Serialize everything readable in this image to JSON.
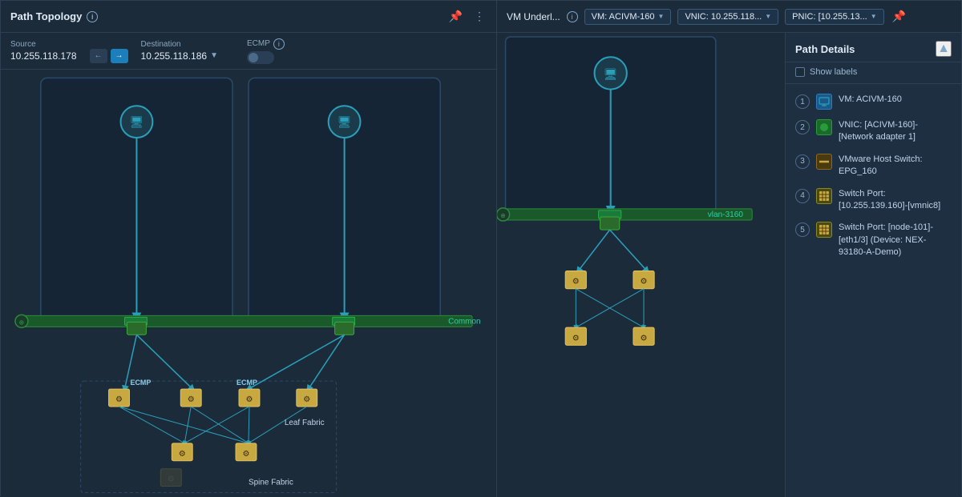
{
  "leftPanel": {
    "title": "Path Topology",
    "source": {
      "label": "Source",
      "value": "10.255.118.178"
    },
    "destination": {
      "label": "Destination",
      "value": "10.255.118.186"
    },
    "ecmp": {
      "label": "ECMP"
    },
    "commonLabel": "Common",
    "ecmpLabel1": "ECMP",
    "ecmpLabel2": "ECMP",
    "leafFabricLabel": "Leaf Fabric",
    "spineFabricLabel": "Spine Fabric"
  },
  "rightPanel": {
    "title": "VM Underl...",
    "vm_dropdown": "VM: ACIVM-160",
    "vnic_dropdown": "VNIC: 10.255.118...",
    "pnic_dropdown": "PNIC: [10.255.13...",
    "vlanLabel": "vlan-3160"
  },
  "pathDetails": {
    "title": "Path Details",
    "showLabels": "Show labels",
    "collapseIcon": "▲",
    "items": [
      {
        "step": "1",
        "iconType": "vm",
        "iconChar": "⊡",
        "text": "VM: ACIVM-160"
      },
      {
        "step": "2",
        "iconType": "vnic",
        "iconChar": "●",
        "text": "VNIC: [ACIVM-160]-[Network adapter 1]"
      },
      {
        "step": "3",
        "iconType": "vswitch",
        "iconChar": "━━",
        "text": "VMware Host Switch: EPG_160"
      },
      {
        "step": "4",
        "iconType": "sport",
        "iconChar": "▦",
        "text": "Switch Port: [10.255.139.160]-[vmnic8]"
      },
      {
        "step": "5",
        "iconType": "sport2",
        "iconChar": "▦",
        "text": "Switch Port: [node-101]-[eth1/3] (Device: NEX-93180-A-Demo)"
      }
    ]
  }
}
